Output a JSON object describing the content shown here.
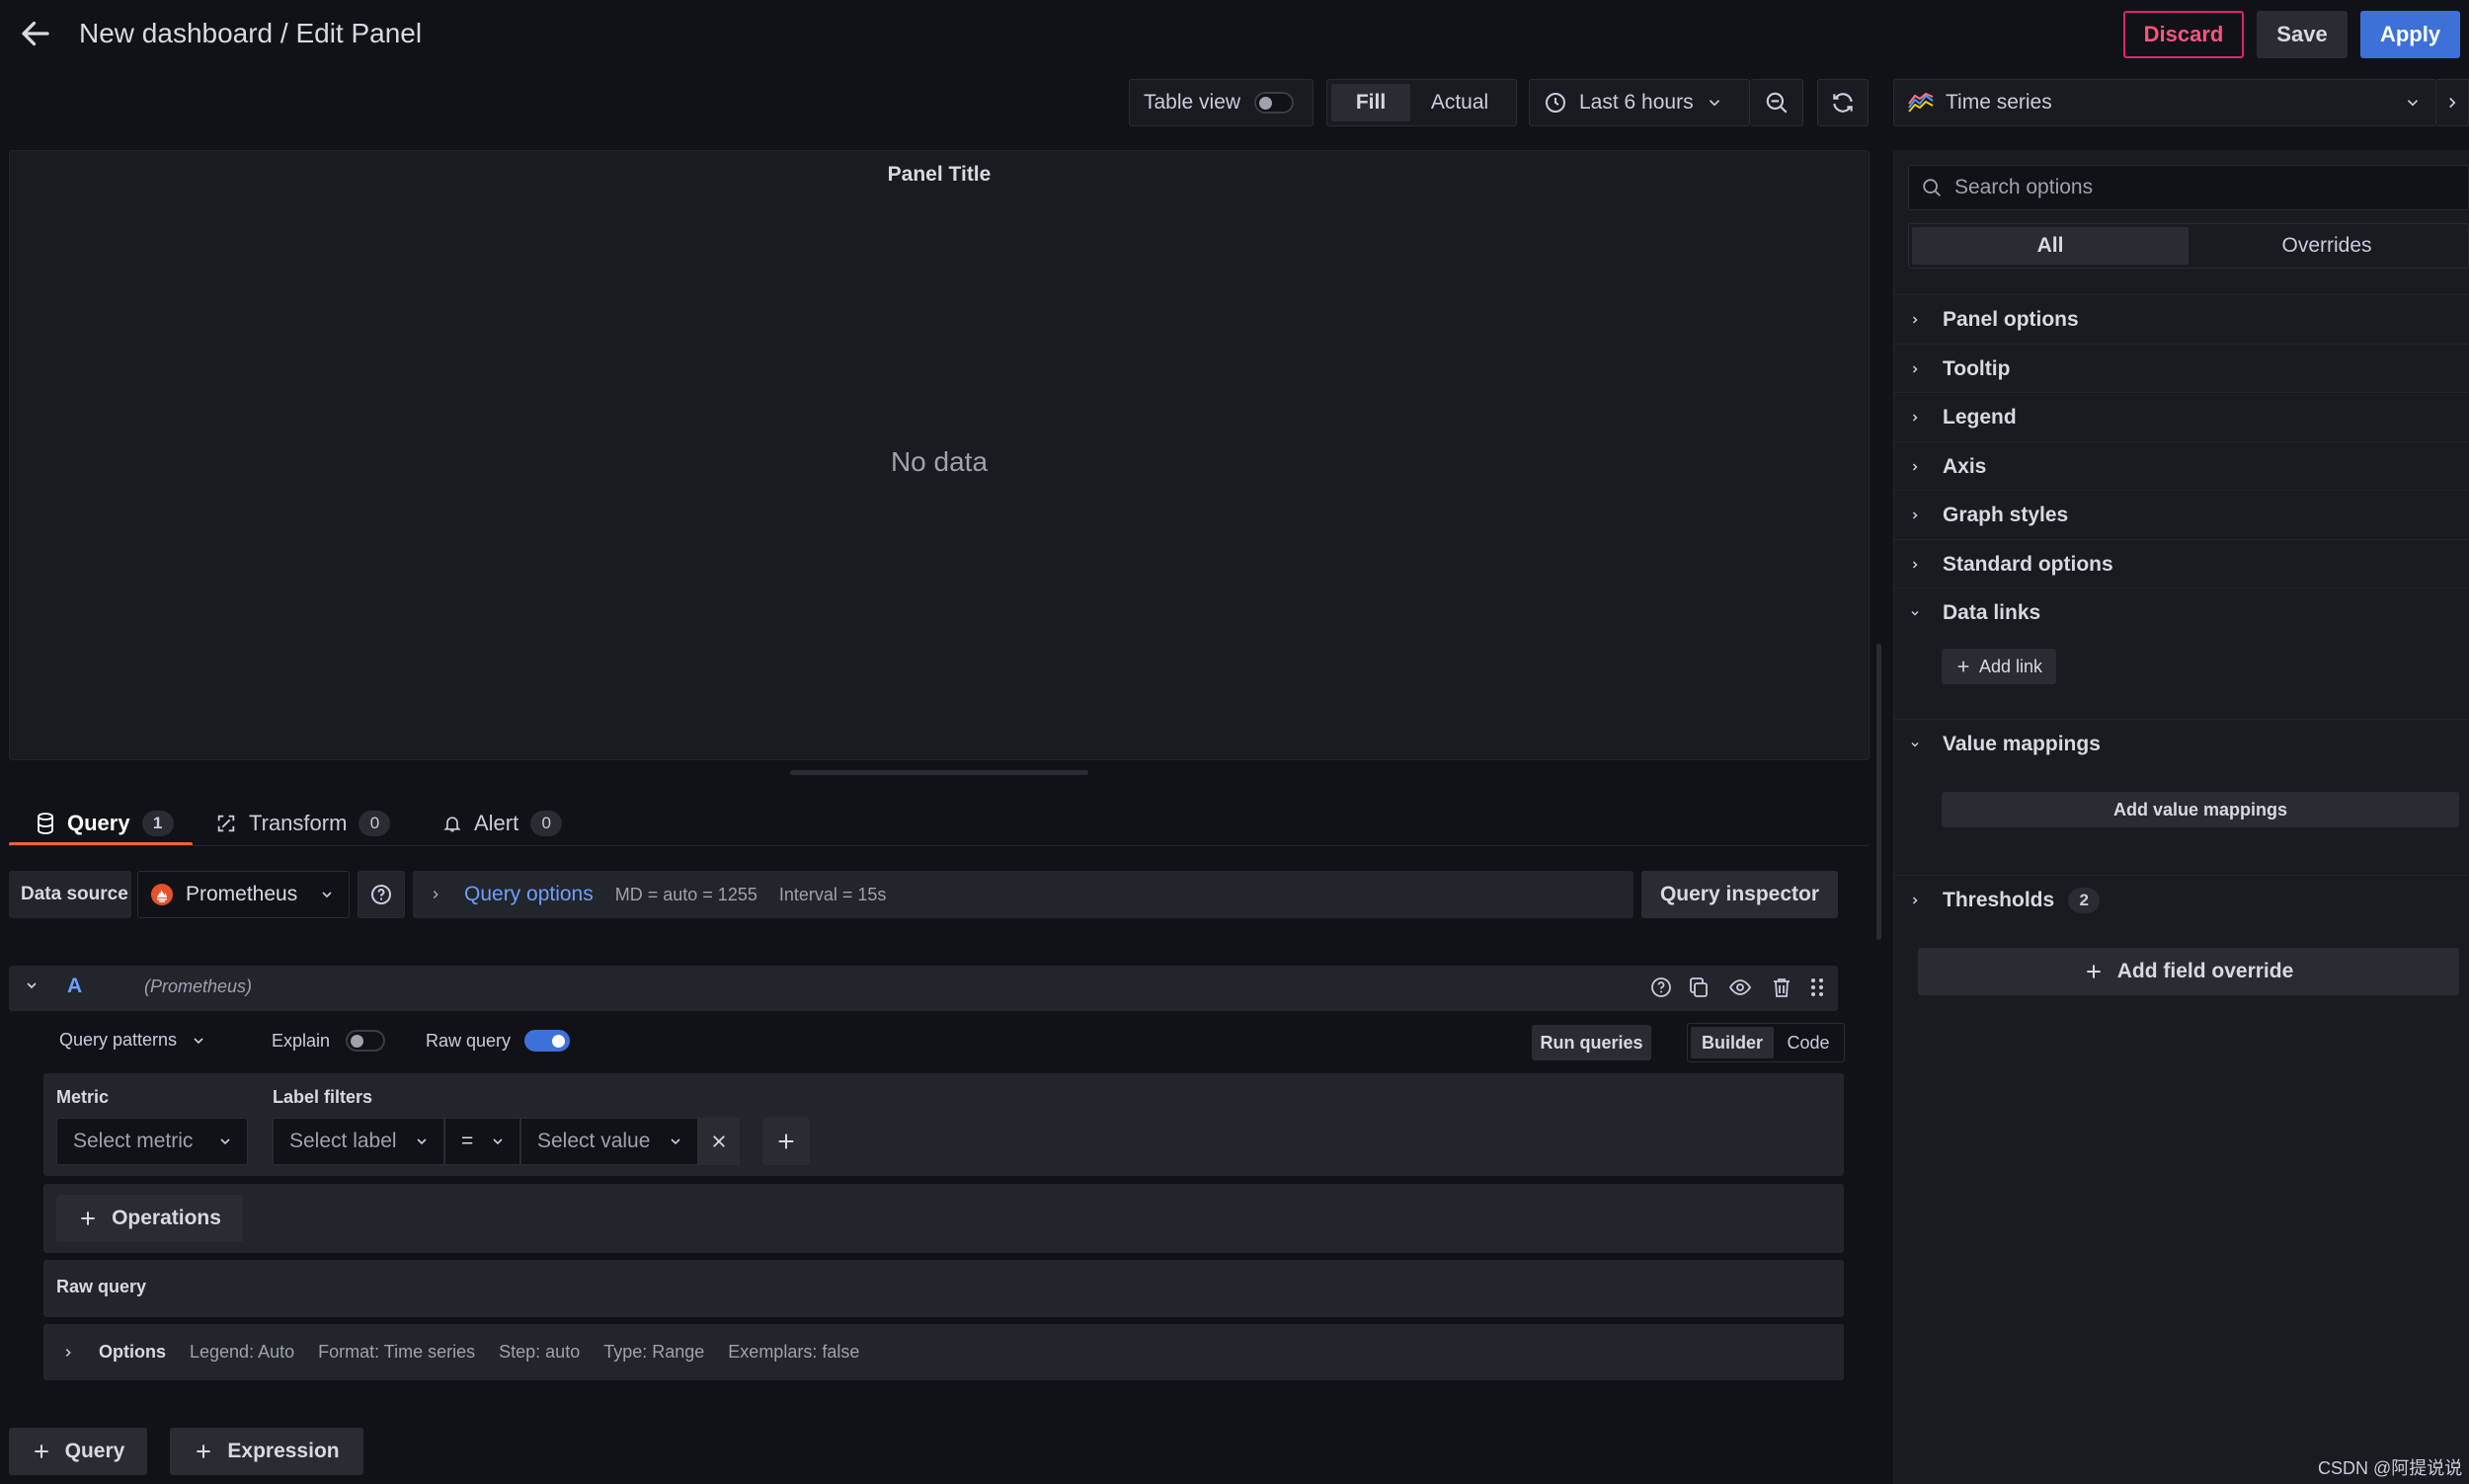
{
  "header": {
    "title": "New dashboard / Edit Panel",
    "discard_label": "Discard",
    "save_label": "Save",
    "apply_label": "Apply"
  },
  "toolbar": {
    "table_view_label": "Table view",
    "table_view_on": false,
    "fill_label": "Fill",
    "actual_label": "Actual",
    "time_range": "Last 6 hours",
    "visualization": "Time series"
  },
  "panel": {
    "title": "Panel Title",
    "empty_message": "No data"
  },
  "tabs": [
    {
      "label": "Query",
      "count": "1"
    },
    {
      "label": "Transform",
      "count": "0"
    },
    {
      "label": "Alert",
      "count": "0"
    }
  ],
  "datasource": {
    "label": "Data source",
    "selected": "Prometheus",
    "query_options_label": "Query options",
    "md_text": "MD = auto = 1255",
    "interval_text": "Interval = 15s",
    "inspector_label": "Query inspector"
  },
  "query": {
    "ref_id": "A",
    "datasource_name": "(Prometheus)",
    "patterns_label": "Query patterns",
    "explain_label": "Explain",
    "explain_on": false,
    "raw_query_label": "Raw query",
    "raw_query_on": true,
    "run_label": "Run queries",
    "builder_label": "Builder",
    "code_label": "Code",
    "metric_label": "Metric",
    "metric_placeholder": "Select metric",
    "label_filters_label": "Label filters",
    "label_placeholder": "Select label",
    "operator": "=",
    "value_placeholder": "Select value",
    "operations_label": "Operations",
    "raw_query_section": "Raw query",
    "options_title": "Options",
    "options_meta": [
      "Legend: Auto",
      "Format: Time series",
      "Step: auto",
      "Type: Range",
      "Exemplars: false"
    ]
  },
  "bottom_buttons": {
    "add_query": "Query",
    "add_expression": "Expression"
  },
  "options_pane": {
    "search_placeholder": "Search options",
    "all_label": "All",
    "overrides_label": "Overrides",
    "categories": [
      {
        "label": "Panel options",
        "expanded": false
      },
      {
        "label": "Tooltip",
        "expanded": false
      },
      {
        "label": "Legend",
        "expanded": false
      },
      {
        "label": "Axis",
        "expanded": false
      },
      {
        "label": "Graph styles",
        "expanded": false
      },
      {
        "label": "Standard options",
        "expanded": false
      },
      {
        "label": "Data links",
        "expanded": true
      },
      {
        "label": "Value mappings",
        "expanded": true
      },
      {
        "label": "Thresholds",
        "expanded": false,
        "count": "2"
      }
    ],
    "add_link_label": "Add link",
    "add_value_mappings_label": "Add value mappings",
    "add_field_override_label": "Add field override"
  },
  "watermark": "CSDN @阿提说说",
  "colors": {
    "background": "#111217",
    "panel": "#181b1f",
    "accent": "#3d71d9",
    "discard": "#e0226e",
    "tab_underline": "#f55f3e",
    "link": "#6e9fff"
  }
}
